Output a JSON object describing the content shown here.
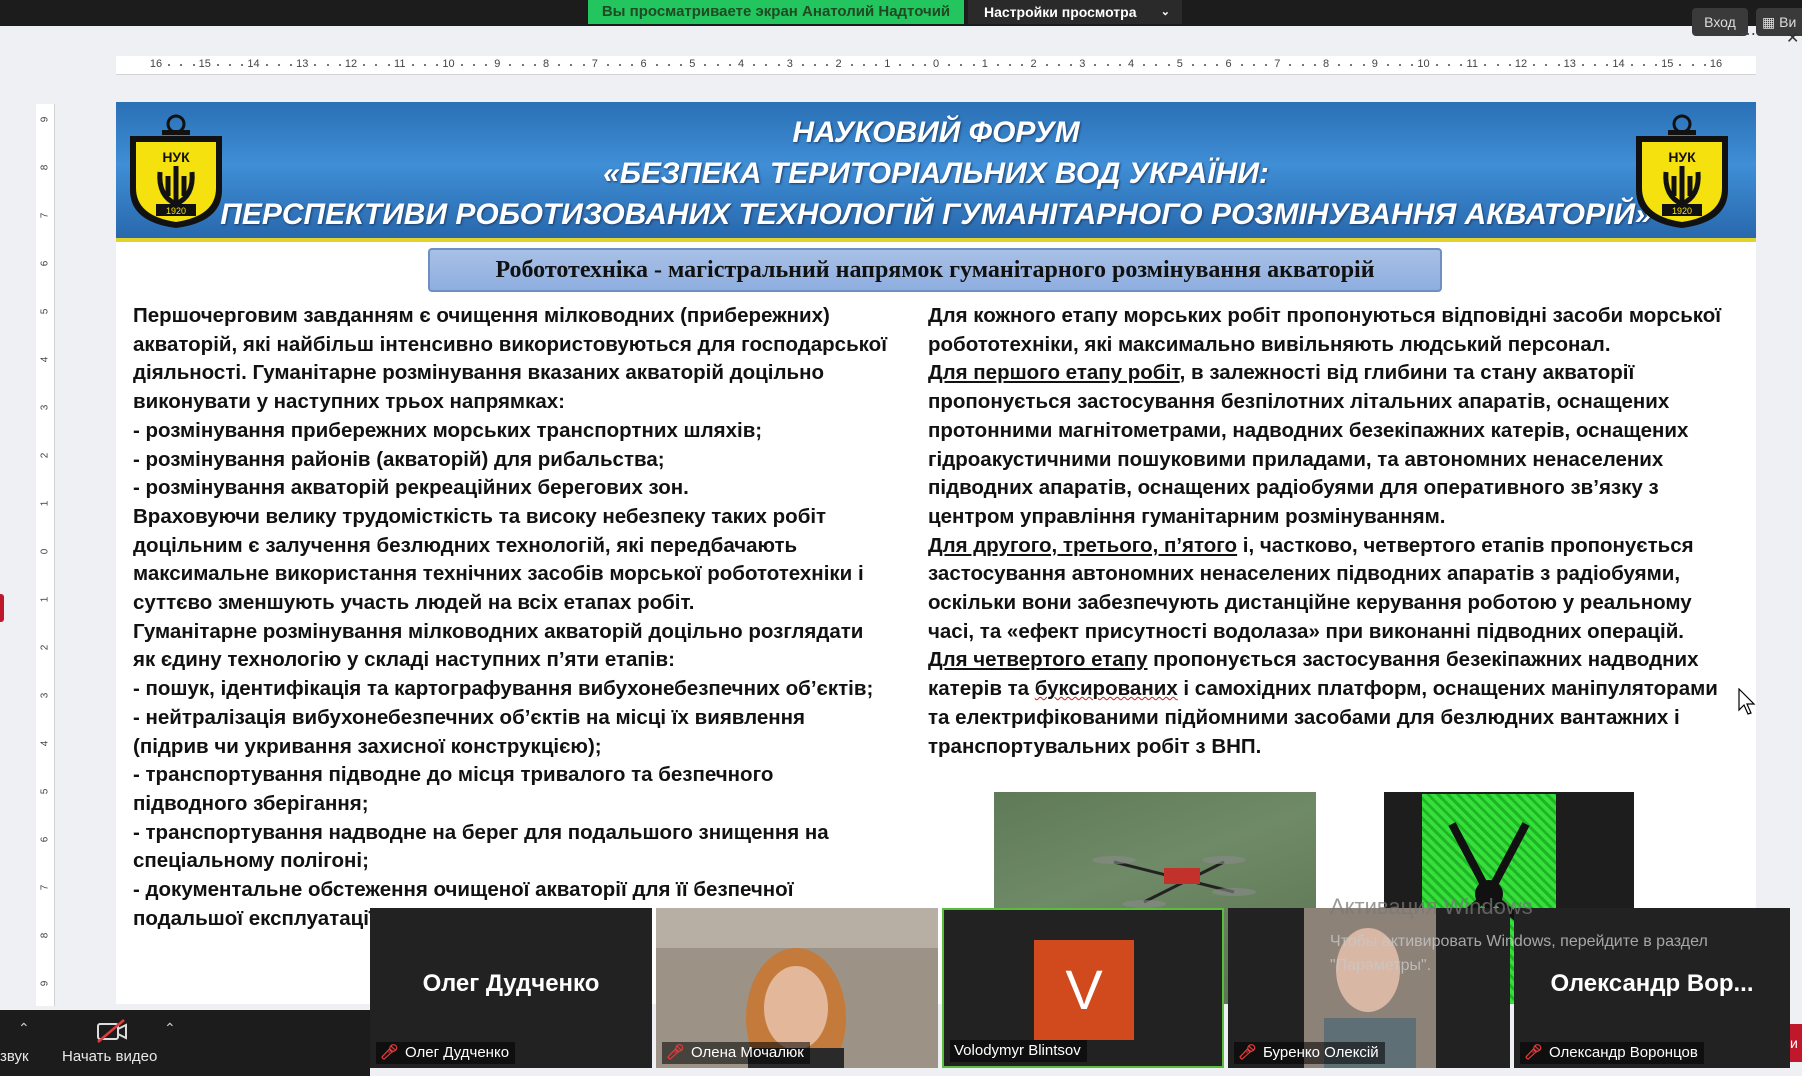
{
  "zoom": {
    "share_prefix": "Вы просматриваете экран",
    "share_name": "Анатолий Надточий",
    "view_settings": "Настройки просмотра",
    "login": "Вход",
    "view": "Ви",
    "participants": [
      {
        "big": "Олег Дудченко",
        "label": "Олег Дудченко",
        "muted": true
      },
      {
        "big": "",
        "label": "Олена Мочалюк",
        "muted": true
      },
      {
        "big": "V",
        "label": "Volodymyr Blintsov",
        "muted": false
      },
      {
        "big": "",
        "label": "Буренко Олексій",
        "muted": true
      },
      {
        "big": "Олександр  Вор...",
        "label": "Олександр Воронцов",
        "muted": true
      }
    ],
    "toolbar": {
      "audio_label": "звук",
      "video_label": "Начать видео"
    },
    "windows_activation": {
      "line1": "Активация Windows",
      "line2": "Чтобы активировать Windows, перейдите в раздел",
      "line3": "\"Параметры\"."
    },
    "mute_icon": "muted-mic-icon",
    "colors": {
      "banner": "#2f7fcb",
      "subtitle_box": "#9db8e3",
      "zoom_green": "#22c55e",
      "logo_yellow": "#f4e10d"
    }
  },
  "ruler": {
    "h_ticks": [
      "16",
      "15",
      "14",
      "13",
      "12",
      "11",
      "10",
      "9",
      "8",
      "7",
      "6",
      "5",
      "4",
      "3",
      "2",
      "1",
      "0",
      "1",
      "2",
      "3",
      "4",
      "5",
      "6",
      "7",
      "8",
      "9",
      "10",
      "11",
      "12",
      "13",
      "14",
      "15",
      "16"
    ],
    "v_ticks": [
      "9",
      "8",
      "7",
      "6",
      "5",
      "4",
      "3",
      "2",
      "1",
      "0",
      "1",
      "2",
      "3",
      "4",
      "5",
      "6",
      "7",
      "8",
      "9"
    ]
  },
  "slide": {
    "logo_text": "НУК",
    "logo_year": "1920",
    "title_line1": "НАУКОВИЙ ФОРУМ",
    "title_line2": "«БЕЗПЕКА ТЕРИТОРІАЛЬНИХ ВОД УКРАЇНИ:",
    "title_line3": "ПЕРСПЕКТИВИ РОБОТИЗОВАНИХ ТЕХНОЛОГІЙ ГУМАНІТАРНОГО РОЗМІНУВАННЯ АКВАТОРІЙ»",
    "subtitle": "Робототехніка - магістральний напрямок гуманітарного розмінування акваторій",
    "left_lines": [
      "Першочерговим завданням є очищення мілководних (прибережних)",
      "акваторій, які найбільш інтенсивно використовуються для господарської",
      "діяльності. Гуманітарне розмінування вказаних акваторій доцільно",
      "виконувати у наступних трьох напрямках:",
      "- розмінування прибережних морських транспортних шляхів;",
      "- розмінування районів (акваторій) для рибальства;",
      "- розмінування акваторій рекреаційних берегових зон.",
      "Враховуючи велику трудомісткість та високу небезпеку таких робіт",
      "доцільним є залучення безлюдних технологій, які передбачають",
      "максимальне використання технічних засобів морської робототехніки і",
      "суттєво зменшують участь людей на всіх етапах робіт.",
      "Гуманітарне розмінування мілководних акваторій доцільно розглядати",
      "як єдину технологію у складі наступних п’яти етапів:",
      "- пошук, ідентифікація та картографування вибухонебезпечних об’єктів;",
      "- нейтралізація вибухонебезпечних об’єктів на місці їх виявлення",
      "(підрив чи укривання захисної конструкцією);",
      "- транспортування підводне до місця тривалого та безпечного",
      "підводного зберігання;",
      "- транспортування надводне на берег для подальшого знищення на",
      "спеціальному полігоні;",
      "- документальне обстеження очищеної акваторії для її безпечної",
      "подальшої експлуатації"
    ],
    "right": {
      "l1": "Для кожного етапу морських робіт пропонуються відповідні засоби морської",
      "l2": "робототехніки, які максимально вивільняють людський персонал.",
      "l3_u": "Для першого етапу робіт",
      "l3_rest": ", в залежності від глибини та стану акваторії",
      "l4": "пропонується застосування безпілотних літальних апаратів, оснащених",
      "l5": "протонними магнітометрами, надводних безекіпажних катерів, оснащених",
      "l6": "гідроакустичними пошуковими приладами, та автономних ненаселених",
      "l7": "підводних апаратів, оснащених радіобуями для оперативного зв’язку з",
      "l8": "центром управління гуманітарним розмінуванням.",
      "l9_u": "Для другого, третього, п’ятого",
      "l9_rest": " і, частково, четвертого етапів пропонується",
      "l10": "застосування автономних ненаселених підводних апаратів з радіобуями,",
      "l11": "оскільки вони забезпечують дистанційне керування роботою у реальному",
      "l12": "часі, та «ефект присутності водолаза» при виконанні підводних операцій.",
      "l13_u": "Для четвертого етапу",
      "l13_rest": " пропонується застосування безекіпажних надводних",
      "l14_a": "катерів та ",
      "l14_u": "буксированих",
      "l14_rest": " і самохідних платформ, оснащених маніпуляторами",
      "l15": "та електрифікованими підйомними засобами для безлюдних вантажних і",
      "l16": "транспортувальних робіт з ВНП."
    }
  }
}
